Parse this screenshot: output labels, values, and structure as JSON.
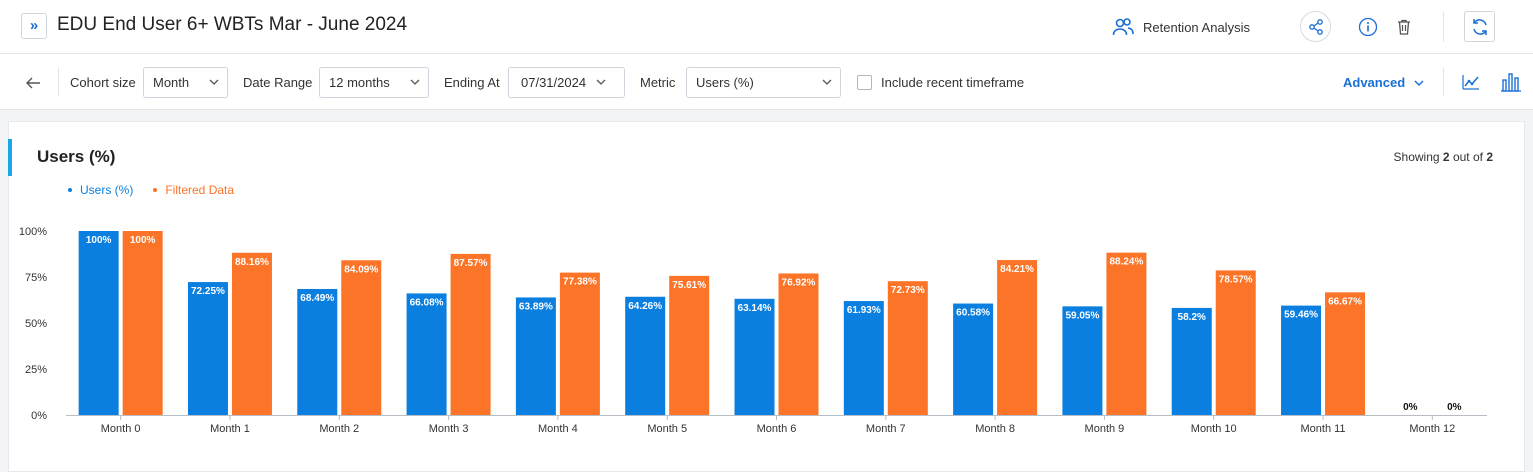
{
  "header": {
    "expand_icon": "double-chevron-right",
    "title": "EDU End User 6+ WBTs Mar - June 2024",
    "analysis_label": "Retention Analysis",
    "analysis_icon": "users-icon",
    "share_icon": "share-icon",
    "info_icon": "info-icon",
    "delete_icon": "trash-icon",
    "refresh_icon": "refresh-icon"
  },
  "toolbar": {
    "back_icon": "arrow-left",
    "cohort_label": "Cohort size",
    "cohort_value": "Month",
    "range_label": "Date Range",
    "range_value": "12 months",
    "ending_label": "Ending At",
    "ending_value": "07/31/2024",
    "metric_label": "Metric",
    "metric_value": "Users (%)",
    "include_label": "Include recent timeframe",
    "include_checked": false,
    "advanced_label": "Advanced",
    "line_chart_icon": "line-chart-icon",
    "bar_chart_icon": "bar-chart-icon"
  },
  "panel": {
    "title": "Users (%)",
    "showing_prefix": "Showing",
    "showing_count": "2",
    "showing_mid": "out of",
    "showing_total": "2"
  },
  "colors": {
    "series1": "#0a7fe0",
    "series2": "#fb7428",
    "accent": "#1a6fd6"
  },
  "chart_data": {
    "type": "bar",
    "categories": [
      "Month 0",
      "Month 1",
      "Month 2",
      "Month 3",
      "Month 4",
      "Month 5",
      "Month 6",
      "Month 7",
      "Month 8",
      "Month 9",
      "Month 10",
      "Month 11",
      "Month 12"
    ],
    "series": [
      {
        "name": "Users (%)",
        "values": [
          100,
          72.25,
          68.49,
          66.08,
          63.89,
          64.26,
          63.14,
          61.93,
          60.58,
          59.05,
          58.2,
          59.46,
          0
        ],
        "labels": [
          "100%",
          "72.25%",
          "68.49%",
          "66.08%",
          "63.89%",
          "64.26%",
          "63.14%",
          "61.93%",
          "60.58%",
          "59.05%",
          "58.2%",
          "59.46%",
          "0%"
        ]
      },
      {
        "name": "Filtered Data",
        "values": [
          100,
          88.16,
          84.09,
          87.57,
          77.38,
          75.61,
          76.92,
          72.73,
          84.21,
          88.24,
          78.57,
          66.67,
          0
        ],
        "labels": [
          "100%",
          "88.16%",
          "84.09%",
          "87.57%",
          "77.38%",
          "75.61%",
          "76.92%",
          "72.73%",
          "84.21%",
          "88.24%",
          "78.57%",
          "66.67%",
          "0%"
        ]
      }
    ],
    "yticks": [
      "0%",
      "25%",
      "50%",
      "75%",
      "100%"
    ],
    "ylim": [
      0,
      100
    ],
    "legend": "top-left"
  }
}
